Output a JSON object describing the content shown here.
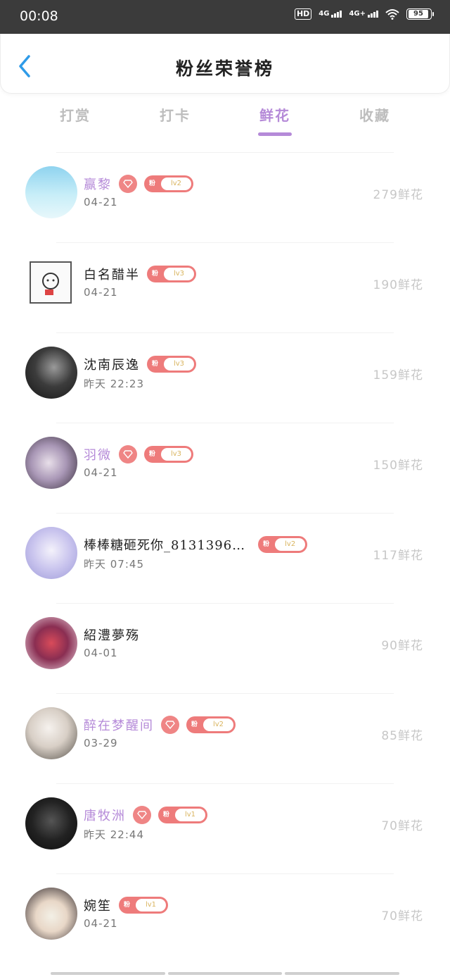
{
  "status_bar": {
    "time": "00:08",
    "hd": "HD",
    "net1": "4G",
    "net2": "4G+",
    "battery": "95"
  },
  "header": {
    "title": "粉丝荣誉榜"
  },
  "tabs": [
    {
      "label": "打赏",
      "active": false
    },
    {
      "label": "打卡",
      "active": false
    },
    {
      "label": "鲜花",
      "active": true
    },
    {
      "label": "收藏",
      "active": false
    }
  ],
  "badge_prefix": "粉",
  "fans": [
    {
      "name": "赢黎",
      "vip": true,
      "diamond": true,
      "level": "lv2",
      "date": "04-21",
      "count": "279鲜花"
    },
    {
      "name": "白名醋半",
      "vip": false,
      "diamond": false,
      "level": "lv3",
      "date": "04-21",
      "count": "190鲜花"
    },
    {
      "name": "沈南辰逸",
      "vip": false,
      "diamond": false,
      "level": "lv3",
      "date": "昨天 22:23",
      "count": "159鲜花"
    },
    {
      "name": "羽微",
      "vip": true,
      "diamond": true,
      "level": "lv3",
      "date": "04-21",
      "count": "150鲜花"
    },
    {
      "name": "棒棒糖砸死你_8131396…",
      "vip": false,
      "diamond": false,
      "level": "lv2",
      "date": "昨天 07:45",
      "count": "117鲜花"
    },
    {
      "name": "紹澧夢殇",
      "vip": false,
      "diamond": false,
      "level": "",
      "date": "04-01",
      "count": "90鲜花"
    },
    {
      "name": "醉在梦醒间",
      "vip": true,
      "diamond": true,
      "level": "lv2",
      "date": "03-29",
      "count": "85鲜花"
    },
    {
      "name": "唐牧洲",
      "vip": true,
      "diamond": true,
      "level": "lv1",
      "date": "昨天 22:44",
      "count": "70鲜花"
    },
    {
      "name": "婉笙",
      "vip": false,
      "diamond": false,
      "level": "lv1",
      "date": "04-21",
      "count": "70鲜花"
    }
  ],
  "colors": {
    "accent": "#b58ad8",
    "badge": "#ee7b7b",
    "back": "#2f9be8",
    "count": "#c7c7c7"
  }
}
